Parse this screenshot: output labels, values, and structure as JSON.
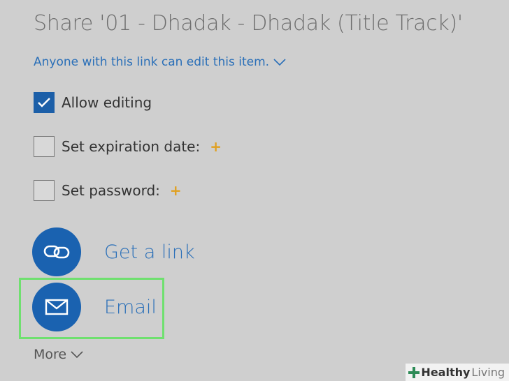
{
  "header": {
    "title": "Share '01 - Dhadak - Dhadak (Title Track)'"
  },
  "permission": {
    "label": "Anyone with this link can edit this item."
  },
  "options": [
    {
      "label": "Allow editing",
      "checked": true,
      "premium": false
    },
    {
      "label": "Set expiration date:",
      "checked": false,
      "premium": true
    },
    {
      "label": "Set password:",
      "checked": false,
      "premium": true
    }
  ],
  "premium_marker": "+",
  "actions": {
    "get_link": {
      "label": "Get a link",
      "icon": "link-icon"
    },
    "email": {
      "label": "Email",
      "icon": "envelope-icon"
    }
  },
  "more": {
    "label": "More"
  },
  "watermark": {
    "part1": "Healthy",
    "part2": "Living"
  },
  "colors": {
    "accent": "#1a62b0",
    "link_text": "#2a6fb8",
    "premium": "#e0a020",
    "highlight": "#6fe06f",
    "background": "#cfcfcf"
  }
}
